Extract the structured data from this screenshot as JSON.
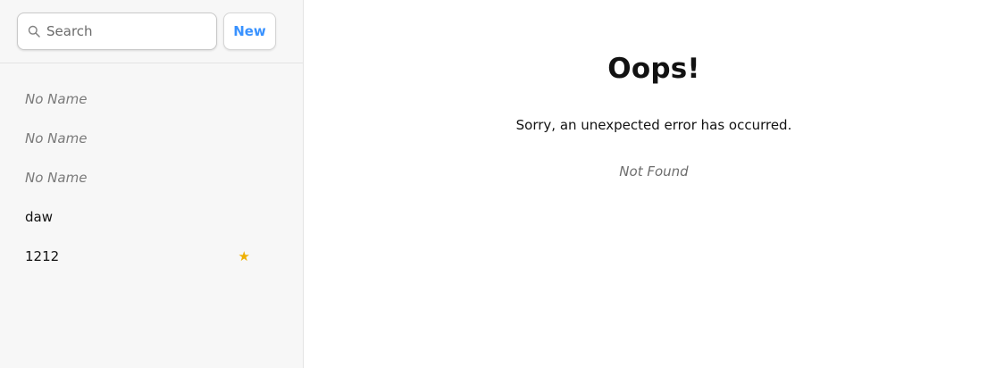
{
  "sidebar": {
    "search": {
      "placeholder": "Search",
      "value": ""
    },
    "new_button_label": "New",
    "contacts": [
      {
        "label": "No Name",
        "favorite": false
      },
      {
        "label": "No Name",
        "favorite": false
      },
      {
        "label": "No Name",
        "favorite": false
      },
      {
        "label": "daw",
        "favorite": false
      },
      {
        "label": "1212",
        "favorite": true,
        "star": "★"
      }
    ]
  },
  "main": {
    "title": "Oops!",
    "message": "Sorry, an unexpected error has occurred.",
    "status": "Not Found"
  },
  "colors": {
    "accent": "#3992ff",
    "star": "#eeb004",
    "sidebar_bg": "#f7f7f7"
  },
  "icons": {
    "search": "search-icon",
    "favorite": "star-icon"
  }
}
